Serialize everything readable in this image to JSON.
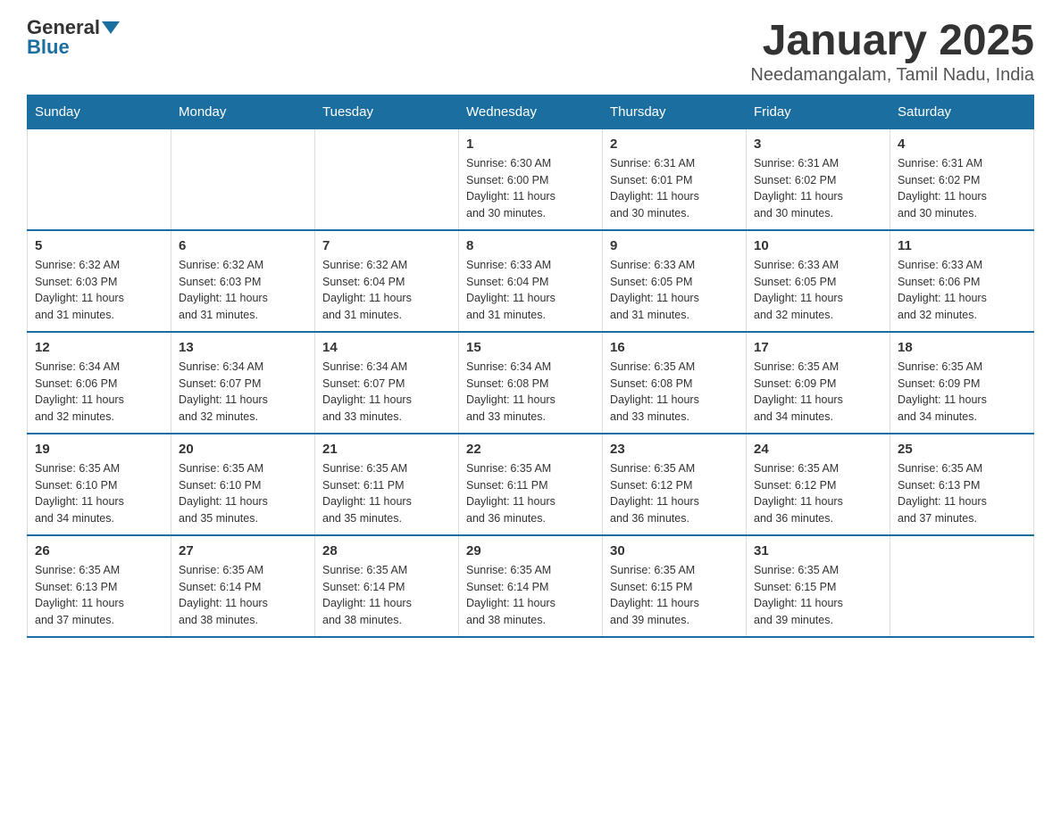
{
  "logo": {
    "general": "General",
    "blue": "Blue"
  },
  "title": "January 2025",
  "subtitle": "Needamangalam, Tamil Nadu, India",
  "weekdays": [
    "Sunday",
    "Monday",
    "Tuesday",
    "Wednesday",
    "Thursday",
    "Friday",
    "Saturday"
  ],
  "weeks": [
    [
      {
        "day": "",
        "info": ""
      },
      {
        "day": "",
        "info": ""
      },
      {
        "day": "",
        "info": ""
      },
      {
        "day": "1",
        "info": "Sunrise: 6:30 AM\nSunset: 6:00 PM\nDaylight: 11 hours\nand 30 minutes."
      },
      {
        "day": "2",
        "info": "Sunrise: 6:31 AM\nSunset: 6:01 PM\nDaylight: 11 hours\nand 30 minutes."
      },
      {
        "day": "3",
        "info": "Sunrise: 6:31 AM\nSunset: 6:02 PM\nDaylight: 11 hours\nand 30 minutes."
      },
      {
        "day": "4",
        "info": "Sunrise: 6:31 AM\nSunset: 6:02 PM\nDaylight: 11 hours\nand 30 minutes."
      }
    ],
    [
      {
        "day": "5",
        "info": "Sunrise: 6:32 AM\nSunset: 6:03 PM\nDaylight: 11 hours\nand 31 minutes."
      },
      {
        "day": "6",
        "info": "Sunrise: 6:32 AM\nSunset: 6:03 PM\nDaylight: 11 hours\nand 31 minutes."
      },
      {
        "day": "7",
        "info": "Sunrise: 6:32 AM\nSunset: 6:04 PM\nDaylight: 11 hours\nand 31 minutes."
      },
      {
        "day": "8",
        "info": "Sunrise: 6:33 AM\nSunset: 6:04 PM\nDaylight: 11 hours\nand 31 minutes."
      },
      {
        "day": "9",
        "info": "Sunrise: 6:33 AM\nSunset: 6:05 PM\nDaylight: 11 hours\nand 31 minutes."
      },
      {
        "day": "10",
        "info": "Sunrise: 6:33 AM\nSunset: 6:05 PM\nDaylight: 11 hours\nand 32 minutes."
      },
      {
        "day": "11",
        "info": "Sunrise: 6:33 AM\nSunset: 6:06 PM\nDaylight: 11 hours\nand 32 minutes."
      }
    ],
    [
      {
        "day": "12",
        "info": "Sunrise: 6:34 AM\nSunset: 6:06 PM\nDaylight: 11 hours\nand 32 minutes."
      },
      {
        "day": "13",
        "info": "Sunrise: 6:34 AM\nSunset: 6:07 PM\nDaylight: 11 hours\nand 32 minutes."
      },
      {
        "day": "14",
        "info": "Sunrise: 6:34 AM\nSunset: 6:07 PM\nDaylight: 11 hours\nand 33 minutes."
      },
      {
        "day": "15",
        "info": "Sunrise: 6:34 AM\nSunset: 6:08 PM\nDaylight: 11 hours\nand 33 minutes."
      },
      {
        "day": "16",
        "info": "Sunrise: 6:35 AM\nSunset: 6:08 PM\nDaylight: 11 hours\nand 33 minutes."
      },
      {
        "day": "17",
        "info": "Sunrise: 6:35 AM\nSunset: 6:09 PM\nDaylight: 11 hours\nand 34 minutes."
      },
      {
        "day": "18",
        "info": "Sunrise: 6:35 AM\nSunset: 6:09 PM\nDaylight: 11 hours\nand 34 minutes."
      }
    ],
    [
      {
        "day": "19",
        "info": "Sunrise: 6:35 AM\nSunset: 6:10 PM\nDaylight: 11 hours\nand 34 minutes."
      },
      {
        "day": "20",
        "info": "Sunrise: 6:35 AM\nSunset: 6:10 PM\nDaylight: 11 hours\nand 35 minutes."
      },
      {
        "day": "21",
        "info": "Sunrise: 6:35 AM\nSunset: 6:11 PM\nDaylight: 11 hours\nand 35 minutes."
      },
      {
        "day": "22",
        "info": "Sunrise: 6:35 AM\nSunset: 6:11 PM\nDaylight: 11 hours\nand 36 minutes."
      },
      {
        "day": "23",
        "info": "Sunrise: 6:35 AM\nSunset: 6:12 PM\nDaylight: 11 hours\nand 36 minutes."
      },
      {
        "day": "24",
        "info": "Sunrise: 6:35 AM\nSunset: 6:12 PM\nDaylight: 11 hours\nand 36 minutes."
      },
      {
        "day": "25",
        "info": "Sunrise: 6:35 AM\nSunset: 6:13 PM\nDaylight: 11 hours\nand 37 minutes."
      }
    ],
    [
      {
        "day": "26",
        "info": "Sunrise: 6:35 AM\nSunset: 6:13 PM\nDaylight: 11 hours\nand 37 minutes."
      },
      {
        "day": "27",
        "info": "Sunrise: 6:35 AM\nSunset: 6:14 PM\nDaylight: 11 hours\nand 38 minutes."
      },
      {
        "day": "28",
        "info": "Sunrise: 6:35 AM\nSunset: 6:14 PM\nDaylight: 11 hours\nand 38 minutes."
      },
      {
        "day": "29",
        "info": "Sunrise: 6:35 AM\nSunset: 6:14 PM\nDaylight: 11 hours\nand 38 minutes."
      },
      {
        "day": "30",
        "info": "Sunrise: 6:35 AM\nSunset: 6:15 PM\nDaylight: 11 hours\nand 39 minutes."
      },
      {
        "day": "31",
        "info": "Sunrise: 6:35 AM\nSunset: 6:15 PM\nDaylight: 11 hours\nand 39 minutes."
      },
      {
        "day": "",
        "info": ""
      }
    ]
  ]
}
